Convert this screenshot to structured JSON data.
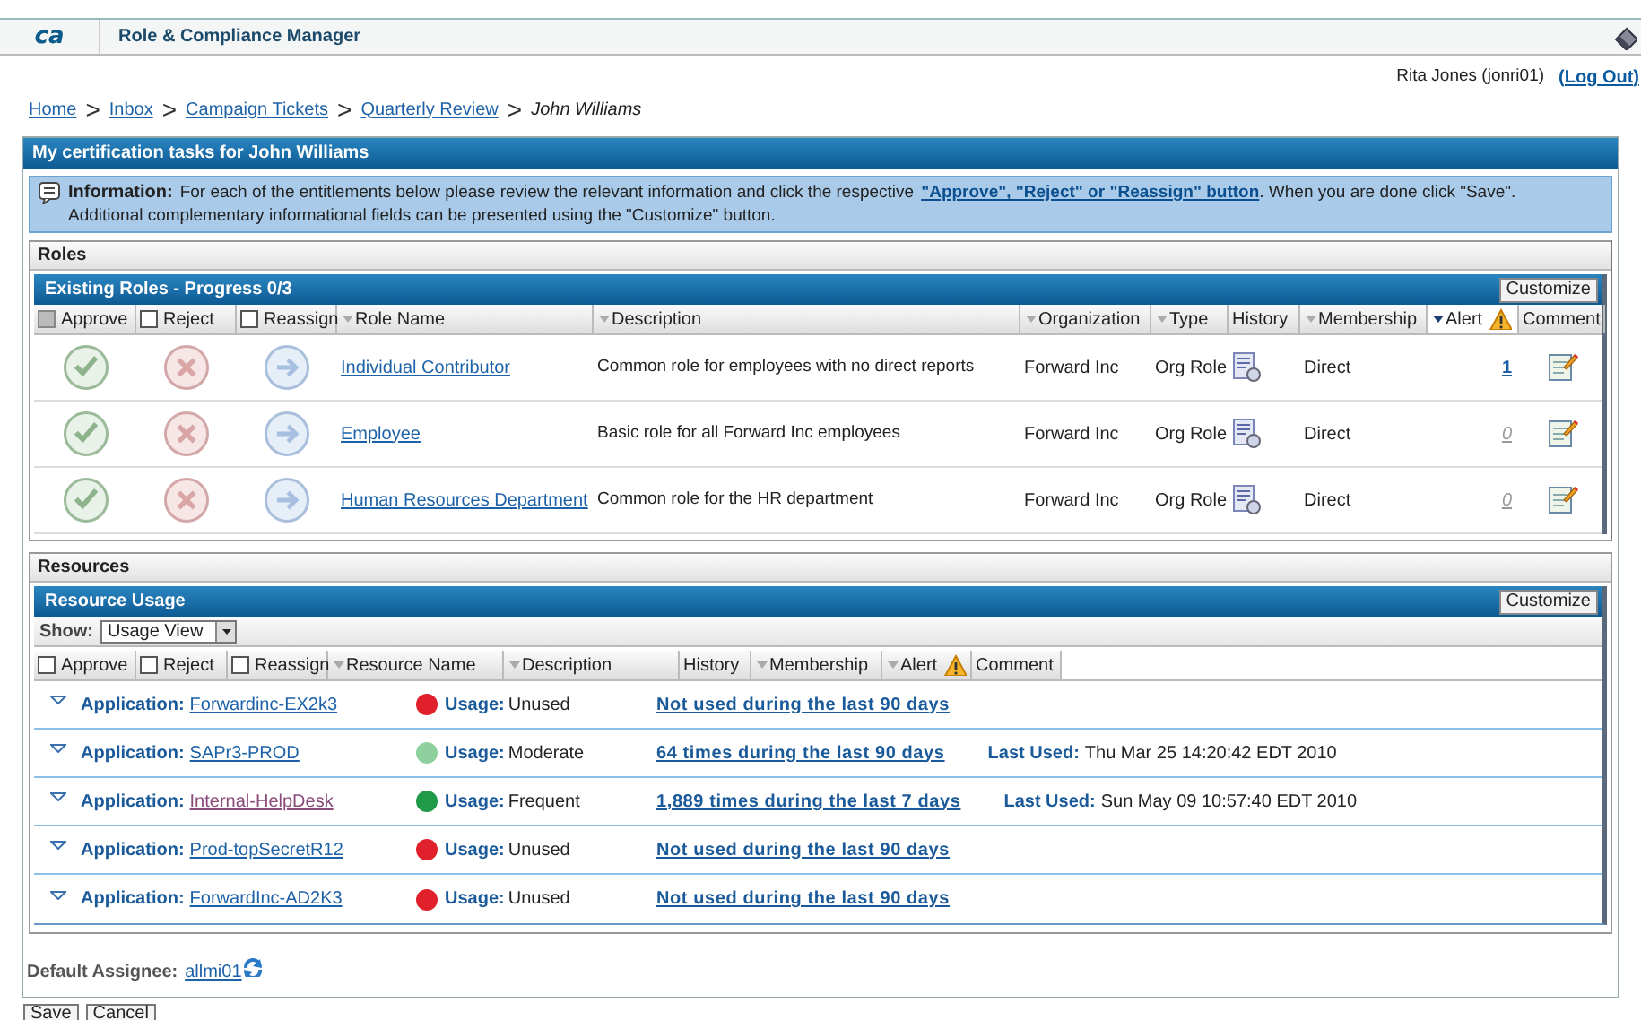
{
  "app": {
    "logo": "ca",
    "title": "Role & Compliance Manager"
  },
  "user": {
    "name": "Rita Jones (jonri01)",
    "logout": "(Log Out)"
  },
  "breadcrumb": [
    {
      "label": "Home",
      "link": true
    },
    {
      "separator": ">",
      "label": "Inbox",
      "link": true
    },
    {
      "separator": ">",
      "label": "Campaign Tickets",
      "link": true
    },
    {
      "separator": ">",
      "label": "Quarterly Review",
      "link": true
    },
    {
      "separator": ">",
      "label": "John Williams",
      "link": false
    }
  ],
  "panel": {
    "title": "My certification tasks for John Williams"
  },
  "info": {
    "label": "Information:",
    "text_before": "For each of the entitlements below please review the relevant information and click the respective",
    "link": "\"Approve\", \"Reject\" or \"Reassign\" button",
    "text_after": ". When you are done click \"Save\".",
    "text_second": "Additional complementary informational fields can be presented using the \"Customize\" button."
  },
  "roles": {
    "section": "Roles",
    "title": "Existing Roles - Progress 0/3",
    "customize": "Customize",
    "columns": [
      {
        "label": "Approve",
        "kind": "checkbox",
        "checked": false,
        "disabled": true
      },
      {
        "label": "Reject",
        "kind": "checkbox",
        "checked": false,
        "disabled": false
      },
      {
        "label": "Reassign",
        "kind": "checkbox",
        "checked": false,
        "disabled": false
      },
      {
        "label": "Role Name",
        "kind": "sort",
        "active": false
      },
      {
        "label": "Description",
        "kind": "sort",
        "active": false
      },
      {
        "label": "Organization",
        "kind": "sort",
        "active": false
      },
      {
        "label": "Type",
        "kind": "sort",
        "active": false
      },
      {
        "label": "History",
        "kind": "plain"
      },
      {
        "label": "Membership",
        "kind": "sort",
        "active": false
      },
      {
        "label": "Alert",
        "kind": "alert",
        "active": true
      },
      {
        "label": "Comment",
        "kind": "plain"
      }
    ],
    "rows": [
      {
        "name": "Individual Contributor",
        "description": "Common role for employees with no direct reports",
        "organization": "Forward Inc",
        "type": "Org Role",
        "membership": "Direct",
        "alerts": "1",
        "alerts_active": true
      },
      {
        "name": "Employee",
        "description": "Basic role for all Forward Inc employees",
        "organization": "Forward Inc",
        "type": "Org Role",
        "membership": "Direct",
        "alerts": "0",
        "alerts_active": false
      },
      {
        "name": "Human Resources Department",
        "description": "Common role for the HR department",
        "organization": "Forward Inc",
        "type": "Org Role",
        "membership": "Direct",
        "alerts": "0",
        "alerts_active": false
      }
    ]
  },
  "resources": {
    "section": "Resources",
    "title": "Resource Usage",
    "customize": "Customize",
    "show_label": "Show:",
    "show_value": "Usage View",
    "columns": [
      {
        "label": "Approve",
        "kind": "checkbox",
        "checked": false,
        "disabled": false
      },
      {
        "label": "Reject",
        "kind": "checkbox",
        "checked": false,
        "disabled": false
      },
      {
        "label": "Reassign",
        "kind": "checkbox",
        "checked": false,
        "disabled": false
      },
      {
        "label": "Resource Name",
        "kind": "sort",
        "active": false
      },
      {
        "label": "Description",
        "kind": "sort",
        "active": false
      },
      {
        "label": "History",
        "kind": "plain"
      },
      {
        "label": "Membership",
        "kind": "sort",
        "active": false
      },
      {
        "label": "Alert",
        "kind": "alert",
        "active": false
      },
      {
        "label": "Comment",
        "kind": "plain"
      }
    ],
    "rows": [
      {
        "type_label": "Application:",
        "name": "Forwardinc-EX2k3",
        "visited": false,
        "color": "#e0202a",
        "usage_label": "Usage:",
        "usage": "Unused",
        "count": "Not used during the last 90 days"
      },
      {
        "type_label": "Application:",
        "name": "SAPr3-PROD",
        "visited": false,
        "color": "#8fd19e",
        "usage_label": "Usage:",
        "usage": "Moderate",
        "count": "64 times during the last 90 days",
        "last_used_label": "Last Used:",
        "last_used": "Thu Mar 25 14:20:42 EDT 2010"
      },
      {
        "type_label": "Application:",
        "name": "Internal-HelpDesk",
        "visited": true,
        "color": "#1f9a48",
        "usage_label": "Usage:",
        "usage": "Frequent",
        "count": "1,889 times during the last 7 days",
        "last_used_label": "Last Used:",
        "last_used": "Sun May 09 10:57:40 EDT 2010"
      },
      {
        "type_label": "Application:",
        "name": "Prod-topSecretR12",
        "visited": false,
        "color": "#e0202a",
        "usage_label": "Usage:",
        "usage": "Unused",
        "count": "Not used during the last 90 days"
      },
      {
        "type_label": "Application:",
        "name": "ForwardInc-AD2K3",
        "visited": false,
        "color": "#e0202a",
        "usage_label": "Usage:",
        "usage": "Unused",
        "count": "Not used during the last 90 days"
      }
    ]
  },
  "default_assignee": {
    "label": "Default Assignee:",
    "value": "allmi01"
  },
  "buttons": [
    "Save",
    "Cancel"
  ]
}
